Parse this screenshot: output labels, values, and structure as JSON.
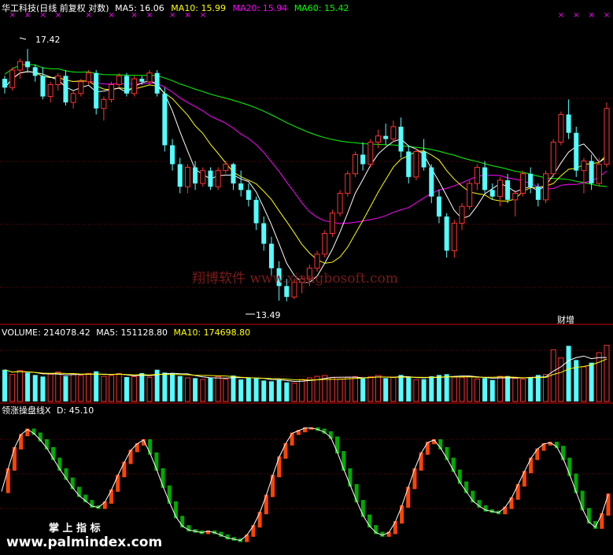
{
  "main_panel": {
    "stock_title": "华工科技(日线 前复权 对数)",
    "ma5_label": "MA5: 16.06",
    "ma10_label": "MA10: 15.99",
    "ma20_label": "MA20: 15.94",
    "ma60_label": "MA60: 15.42",
    "high_marker": "17.42",
    "low_marker": "13.49",
    "badge": "财增",
    "watermark": "翔博软件 www.xiangbosoft.com"
  },
  "volume_panel": {
    "volume_label": "VOLUME: 214078.42",
    "ma5_label": "MA5: 151128.80",
    "ma10_label": "MA10: 174698.80"
  },
  "indicator_panel": {
    "title": "领涨操盘线X",
    "d_label": "D: 45.10"
  },
  "footer": {
    "brand_cn": "掌 上 指 标",
    "brand_url": "www.palmindex.com"
  },
  "colors": {
    "background": "#000000",
    "up": "#ff3232",
    "down": "#54ffff",
    "ma5": "#ffffff",
    "ma10": "#ffff00",
    "ma20": "#ff00ff",
    "ma60": "#00ff00",
    "grid": "#7f0000",
    "divider": "#cc0000",
    "x_marker": "#ff00ff",
    "ind_up": "#ff4400",
    "ind_down": "#00aa00"
  },
  "chart_data": [
    {
      "type": "candlestick",
      "title": "华工科技(日线 前复权 对数)",
      "ylim": [
        13.2,
        17.9
      ],
      "price_high": 17.42,
      "price_low": 13.49,
      "candles": [
        [
          16.9,
          16.95,
          16.65,
          16.75
        ],
        [
          16.75,
          17.1,
          16.7,
          17.05
        ],
        [
          17.05,
          17.25,
          16.9,
          17.2
        ],
        [
          17.2,
          17.42,
          17.0,
          17.1
        ],
        [
          17.1,
          17.15,
          16.85,
          16.95
        ],
        [
          16.95,
          17.1,
          16.55,
          16.6
        ],
        [
          16.6,
          16.85,
          16.5,
          16.8
        ],
        [
          16.8,
          17.0,
          16.7,
          16.95
        ],
        [
          16.95,
          17.05,
          16.45,
          16.5
        ],
        [
          16.5,
          16.7,
          16.4,
          16.65
        ],
        [
          16.65,
          16.9,
          16.6,
          16.85
        ],
        [
          16.85,
          17.05,
          16.8,
          17.0
        ],
        [
          17.0,
          17.05,
          16.3,
          16.4
        ],
        [
          16.4,
          16.6,
          16.2,
          16.55
        ],
        [
          16.55,
          16.85,
          16.5,
          16.8
        ],
        [
          16.8,
          17.0,
          16.75,
          16.95
        ],
        [
          16.95,
          17.0,
          16.6,
          16.65
        ],
        [
          16.65,
          16.95,
          16.6,
          16.9
        ],
        [
          16.9,
          16.95,
          16.8,
          16.85
        ],
        [
          16.85,
          17.05,
          16.8,
          17.0
        ],
        [
          17.0,
          17.05,
          16.6,
          16.65
        ],
        [
          16.65,
          16.75,
          15.7,
          15.8
        ],
        [
          15.8,
          15.9,
          15.4,
          15.5
        ],
        [
          15.5,
          15.6,
          15.05,
          15.15
        ],
        [
          15.15,
          15.5,
          15.05,
          15.45
        ],
        [
          15.45,
          15.55,
          15.1,
          15.2
        ],
        [
          15.2,
          15.45,
          15.15,
          15.4
        ],
        [
          15.4,
          15.45,
          15.1,
          15.15
        ],
        [
          15.15,
          15.45,
          15.1,
          15.4
        ],
        [
          15.4,
          15.55,
          15.35,
          15.5
        ],
        [
          15.5,
          15.52,
          15.1,
          15.2
        ],
        [
          15.2,
          15.4,
          15.0,
          15.1
        ],
        [
          15.1,
          15.2,
          14.85,
          14.95
        ],
        [
          14.95,
          15.0,
          14.5,
          14.6
        ],
        [
          14.6,
          14.7,
          14.2,
          14.3
        ],
        [
          14.3,
          14.4,
          13.85,
          13.95
        ],
        [
          13.95,
          14.05,
          13.5,
          13.7
        ],
        [
          13.7,
          13.8,
          13.49,
          13.55
        ],
        [
          13.55,
          13.8,
          13.52,
          13.75
        ],
        [
          13.75,
          13.85,
          13.6,
          13.8
        ],
        [
          13.8,
          14.0,
          13.7,
          13.95
        ],
        [
          13.95,
          14.2,
          13.9,
          14.15
        ],
        [
          14.15,
          14.5,
          14.1,
          14.45
        ],
        [
          14.45,
          14.8,
          14.4,
          14.75
        ],
        [
          14.75,
          15.1,
          14.7,
          15.05
        ],
        [
          15.05,
          15.4,
          15.0,
          15.35
        ],
        [
          15.35,
          15.7,
          15.3,
          15.65
        ],
        [
          15.65,
          15.85,
          15.4,
          15.5
        ],
        [
          15.5,
          15.9,
          15.45,
          15.85
        ],
        [
          15.85,
          16.05,
          15.75,
          15.95
        ],
        [
          15.95,
          16.15,
          15.8,
          15.9
        ],
        [
          15.9,
          16.2,
          15.85,
          16.1
        ],
        [
          16.1,
          16.25,
          15.6,
          15.7
        ],
        [
          15.7,
          15.8,
          15.2,
          15.3
        ],
        [
          15.3,
          15.75,
          15.25,
          15.7
        ],
        [
          15.7,
          15.9,
          15.4,
          15.45
        ],
        [
          15.45,
          15.5,
          14.9,
          15.0
        ],
        [
          15.0,
          15.1,
          14.6,
          14.7
        ],
        [
          14.7,
          14.75,
          14.1,
          14.2
        ],
        [
          14.2,
          14.65,
          14.1,
          14.6
        ],
        [
          14.6,
          14.9,
          14.5,
          14.85
        ],
        [
          14.85,
          15.25,
          14.8,
          15.2
        ],
        [
          15.2,
          15.5,
          15.1,
          15.45
        ],
        [
          15.45,
          15.55,
          15.05,
          15.1
        ],
        [
          15.1,
          15.2,
          14.95,
          15.0
        ],
        [
          15.0,
          15.3,
          14.85,
          15.25
        ],
        [
          15.25,
          15.35,
          14.9,
          14.95
        ],
        [
          14.95,
          15.1,
          14.7,
          15.05
        ],
        [
          15.05,
          15.4,
          15.0,
          15.35
        ],
        [
          15.35,
          15.45,
          15.05,
          15.15
        ],
        [
          15.15,
          15.2,
          14.85,
          14.95
        ],
        [
          14.95,
          15.4,
          14.9,
          15.35
        ],
        [
          15.35,
          15.9,
          15.3,
          15.85
        ],
        [
          15.85,
          16.35,
          15.8,
          16.3
        ],
        [
          16.3,
          16.55,
          15.9,
          16.0
        ],
        [
          16.0,
          16.1,
          15.3,
          15.4
        ],
        [
          15.4,
          15.6,
          15.05,
          15.55
        ],
        [
          15.55,
          15.65,
          15.1,
          15.2
        ],
        [
          15.2,
          15.6,
          15.15,
          15.5
        ],
        [
          15.5,
          16.5,
          15.45,
          16.4
        ]
      ]
    },
    {
      "type": "bar",
      "title": "VOLUME",
      "latest_volume": 214078.42,
      "ma5": 151128.8,
      "ma10": 174698.8,
      "ylim": [
        0,
        240000
      ],
      "values": [
        121000,
        103000,
        118000,
        110000,
        101000,
        95000,
        104000,
        112000,
        97000,
        104000,
        99000,
        107000,
        115000,
        96000,
        99000,
        106000,
        93000,
        95000,
        108000,
        92000,
        121000,
        110000,
        108000,
        97000,
        90000,
        89000,
        84000,
        91000,
        95000,
        85000,
        99000,
        84000,
        90000,
        88000,
        80000,
        77000,
        82000,
        73000,
        70000,
        84000,
        90000,
        96000,
        99000,
        91000,
        86000,
        92000,
        95000,
        88000,
        94000,
        99000,
        89000,
        91000,
        101000,
        92000,
        83000,
        85000,
        96000,
        101000,
        104000,
        93000,
        92000,
        95000,
        86000,
        89000,
        82000,
        96000,
        97000,
        88000,
        85000,
        93000,
        101000,
        103000,
        197000,
        166000,
        212000,
        158000,
        132000,
        148000,
        186000,
        214078
      ]
    },
    {
      "type": "line",
      "title": "领涨操盘线X",
      "ylim": [
        0,
        100
      ],
      "latest_d": 45.1,
      "values": [
        45,
        62,
        78,
        88,
        92,
        89,
        84,
        78,
        70,
        62,
        55,
        48,
        42,
        38,
        34,
        33,
        37,
        46,
        57,
        67,
        76,
        81,
        84,
        74,
        62,
        49,
        37,
        26,
        19,
        16,
        15,
        14,
        15,
        14,
        12,
        10,
        9,
        8,
        12,
        19,
        29,
        42,
        57,
        71,
        81,
        89,
        91,
        93,
        93,
        92,
        90,
        86,
        75,
        62,
        50,
        38,
        27,
        19,
        14,
        12,
        14,
        22,
        34,
        48,
        62,
        74,
        82,
        84,
        78,
        70,
        61,
        52,
        45,
        38,
        34,
        31,
        30,
        29,
        33,
        40,
        50,
        60,
        70,
        77,
        81,
        82,
        79,
        70,
        58,
        45,
        32,
        22,
        18,
        28,
        43
      ]
    }
  ]
}
